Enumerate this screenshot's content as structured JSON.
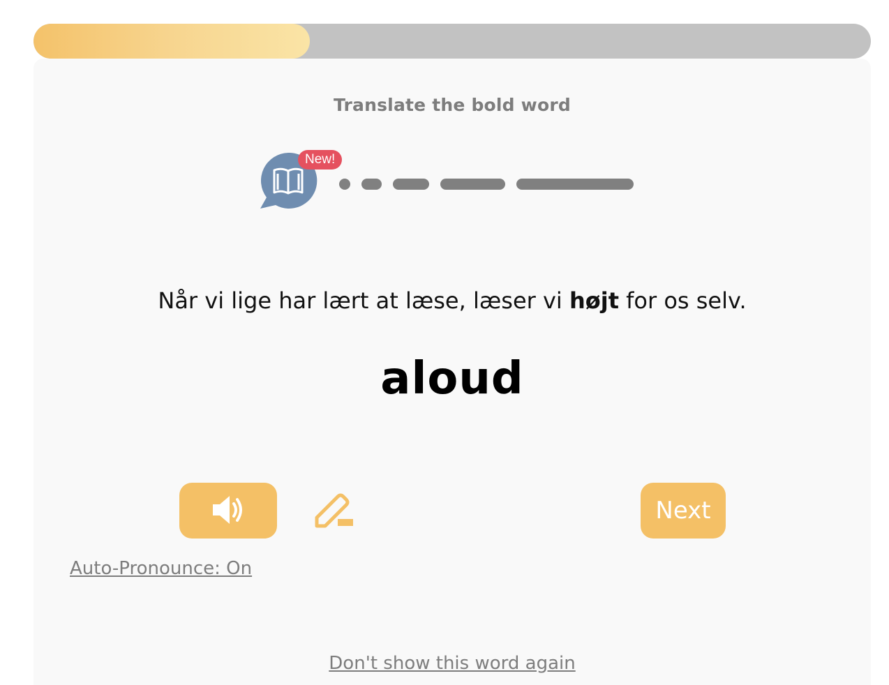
{
  "progress": {
    "fraction": 0.33
  },
  "instruction": "Translate the bold word",
  "badge": {
    "label": "New!"
  },
  "level": {
    "bars": 5,
    "color": "#808080"
  },
  "sentence": {
    "before": "Når vi lige har lært at læse, læser vi ",
    "bold": "højt",
    "after": " for os selv."
  },
  "translation": "aloud",
  "buttons": {
    "next_label": "Next"
  },
  "links": {
    "auto_pronounce": "Auto-Pronounce: On",
    "hide_word": "Don't show this word again"
  },
  "colors": {
    "accent": "#f4c066",
    "badge": "#e5515f",
    "bubble": "#6f8db0",
    "muted": "#7d7d7d"
  },
  "icons": {
    "bubble": "book-icon",
    "speaker": "speaker-icon",
    "edit": "pencil-edit-icon"
  }
}
